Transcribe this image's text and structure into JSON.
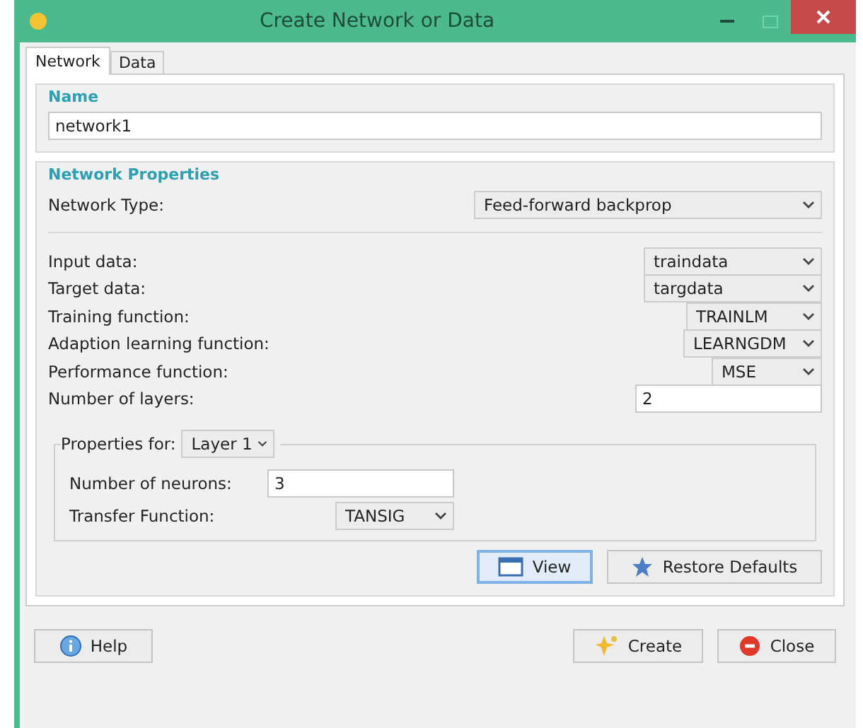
{
  "window": {
    "title": "Create Network or Data"
  },
  "tabs": [
    {
      "label": "Network",
      "selected": true
    },
    {
      "label": "Data",
      "selected": false
    }
  ],
  "name_group": {
    "title": "Name",
    "value": "network1"
  },
  "network_properties": {
    "title": "Network Properties",
    "network_type": {
      "label": "Network Type:",
      "value": "Feed-forward backprop"
    },
    "fields": [
      {
        "kind": "select",
        "label": "Input data:",
        "value": "traindata"
      },
      {
        "kind": "select",
        "label": "Target data:",
        "value": "targdata"
      },
      {
        "kind": "select",
        "label": "Training function:",
        "value": "TRAINLM"
      },
      {
        "kind": "select",
        "label": "Adaption learning function:",
        "value": "LEARNGDM"
      },
      {
        "kind": "select",
        "label": "Performance function:",
        "value": "MSE"
      },
      {
        "kind": "input",
        "label": "Number of layers:",
        "value": "2"
      }
    ],
    "layer_group": {
      "label": "Properties for:",
      "layer": "Layer 1",
      "neurons_label": "Number of neurons:",
      "neurons": "3",
      "transfer_label": "Transfer Function:",
      "transfer": "TANSIG"
    },
    "buttons": [
      {
        "kind": "view",
        "label": "View",
        "focused": true
      },
      {
        "kind": "restore",
        "label": "Restore Defaults",
        "focused": false
      }
    ]
  },
  "footer_buttons": [
    {
      "kind": "help",
      "label": "Help"
    },
    {
      "kind": "create",
      "label": "Create"
    },
    {
      "kind": "close",
      "label": "Close"
    }
  ]
}
